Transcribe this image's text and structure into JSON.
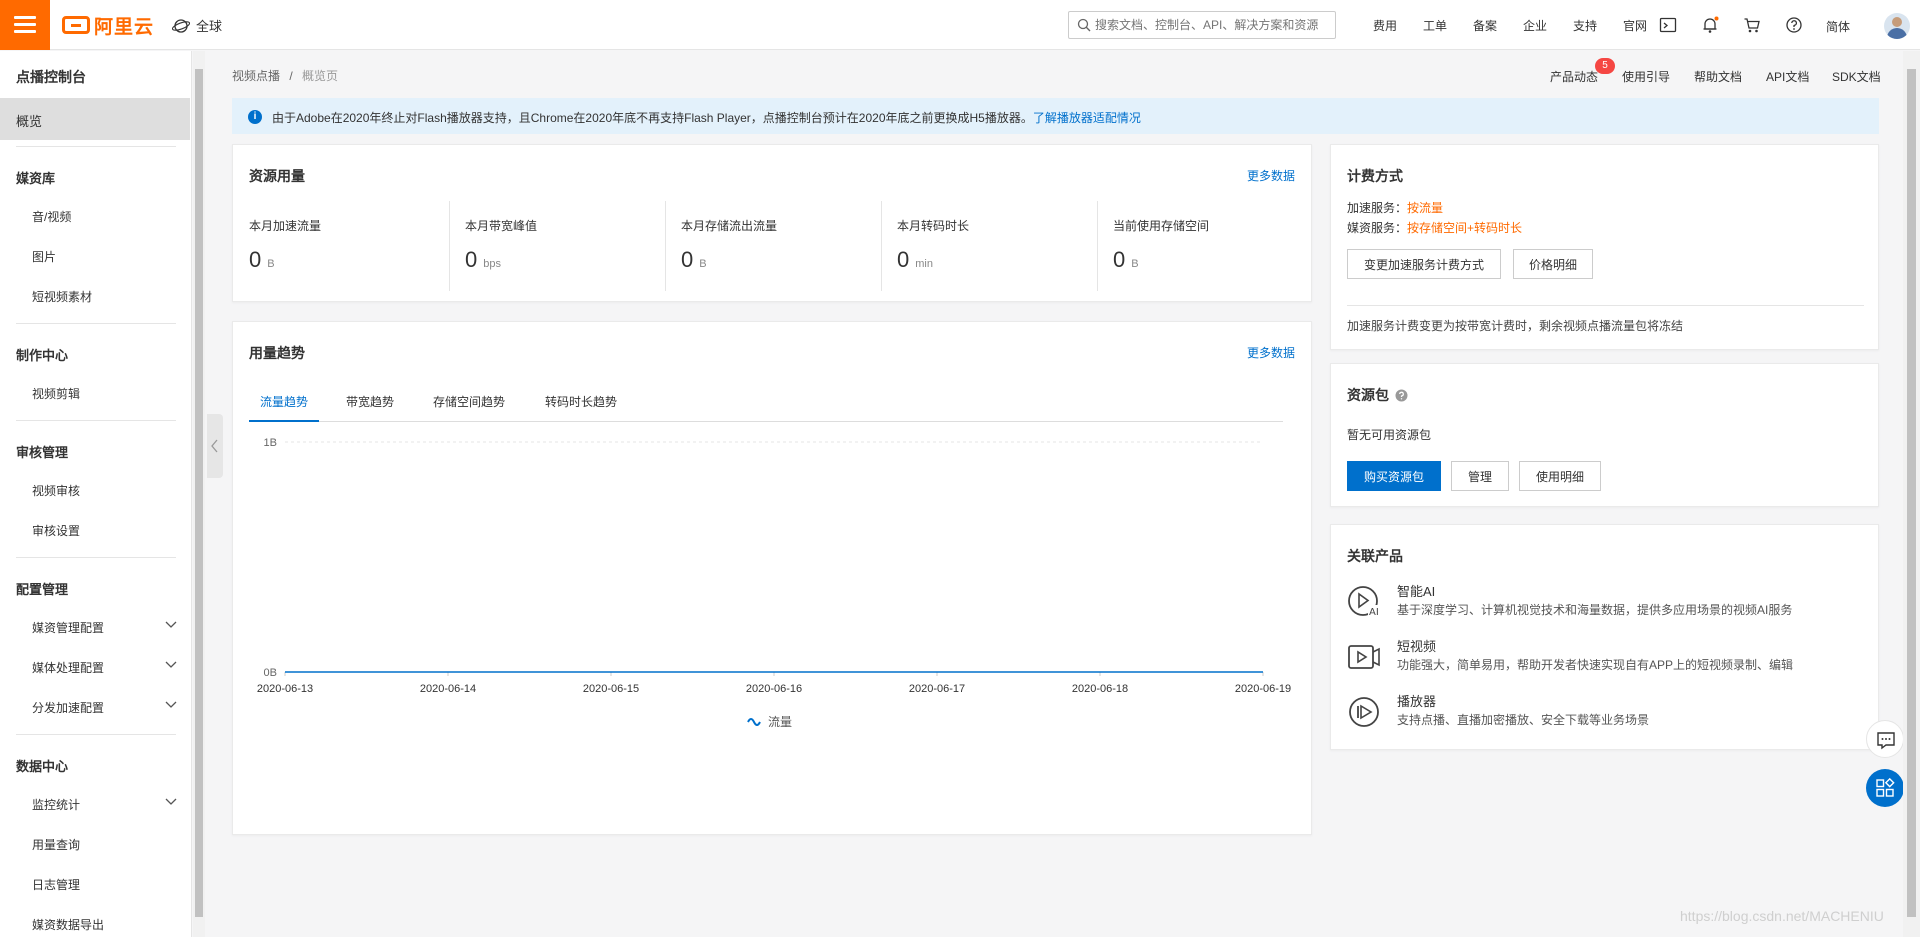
{
  "topbar": {
    "logo": "阿里云",
    "region": "全球",
    "search_placeholder": "搜索文档、控制台、API、解决方案和资源",
    "nav": [
      "费用",
      "工单",
      "备案",
      "企业",
      "支持",
      "官网"
    ],
    "language": "简体"
  },
  "sidebar": {
    "title": "点播控制台",
    "active": "概览",
    "groups": [
      {
        "label": "媒资库",
        "items": [
          "音/视频",
          "图片",
          "短视频素材"
        ]
      },
      {
        "label": "制作中心",
        "items": [
          "视频剪辑"
        ]
      },
      {
        "label": "审核管理",
        "items": [
          "视频审核",
          "审核设置"
        ]
      },
      {
        "label": "配置管理",
        "items": [
          "媒资管理配置",
          "媒体处理配置",
          "分发加速配置"
        ]
      },
      {
        "label": "数据中心",
        "items": [
          "监控统计",
          "用量查询",
          "日志管理",
          "媒资数据导出"
        ]
      }
    ]
  },
  "breadcrumb": {
    "root": "视频点播",
    "sep": "/",
    "current": "概览页"
  },
  "doc_links": {
    "items": [
      "产品动态",
      "使用引导",
      "帮助文档",
      "API文档",
      "SDK文档"
    ],
    "badge": "5"
  },
  "notice": {
    "text": "由于Adobe在2020年终止对Flash播放器支持，且Chrome在2020年底不再支持Flash Player，点播控制台预计在2020年底之前更换成H5播放器。",
    "link": "了解播放器适配情况"
  },
  "resource_usage": {
    "title": "资源用量",
    "more": "更多数据",
    "stats": [
      {
        "label": "本月加速流量",
        "value": "0",
        "unit": "B"
      },
      {
        "label": "本月带宽峰值",
        "value": "0",
        "unit": "bps"
      },
      {
        "label": "本月存储流出流量",
        "value": "0",
        "unit": "B"
      },
      {
        "label": "本月转码时长",
        "value": "0",
        "unit": "min"
      },
      {
        "label": "当前使用存储空间",
        "value": "0",
        "unit": "B"
      }
    ]
  },
  "usage_trend": {
    "title": "用量趋势",
    "more": "更多数据",
    "tabs": [
      "流量趋势",
      "带宽趋势",
      "存储空间趋势",
      "转码时长趋势"
    ],
    "active_tab": "流量趋势"
  },
  "chart_data": {
    "type": "line",
    "x": [
      "2020-06-13",
      "2020-06-14",
      "2020-06-15",
      "2020-06-16",
      "2020-06-17",
      "2020-06-18",
      "2020-06-19"
    ],
    "series": [
      {
        "name": "流量",
        "values": [
          0,
          0,
          0,
          0,
          0,
          0,
          0
        ]
      }
    ],
    "yticks": [
      "0B",
      "1B"
    ],
    "ylim": [
      0,
      1
    ],
    "color": "#0070cc",
    "grid": true,
    "legend": "bottom-center"
  },
  "billing": {
    "title": "计费方式",
    "accel_label": "加速服务：",
    "accel_value": "按流量",
    "media_label": "媒资服务：",
    "media_value": "按存储空间+转码时长",
    "btn_change": "变更加速服务计费方式",
    "btn_price": "价格明细",
    "note": "加速服务计费变更为按带宽计费时，剩余视频点播流量包将冻结"
  },
  "packages": {
    "title": "资源包",
    "empty": "暂无可用资源包",
    "btn_buy": "购买资源包",
    "btn_manage": "管理",
    "btn_detail": "使用明细"
  },
  "related": {
    "title": "关联产品",
    "items": [
      {
        "name": "智能AI",
        "desc": "基于深度学习、计算机视觉技术和海量数据，提供多应用场景的视频AI服务",
        "icon": "ai-play-icon"
      },
      {
        "name": "短视频",
        "desc": "功能强大，简单易用，帮助开发者快速实现自有APP上的短视频录制、编辑",
        "icon": "short-video-icon"
      },
      {
        "name": "播放器",
        "desc": "支持点播、直播加密播放、安全下载等业务场景",
        "icon": "player-icon"
      }
    ]
  },
  "watermark": "https://blog.csdn.net/MACHENIU",
  "colors": {
    "brand": "#ff6a00",
    "primary": "#0070cc",
    "badge": "#f54743",
    "notice_bg": "#e3f1fb"
  }
}
